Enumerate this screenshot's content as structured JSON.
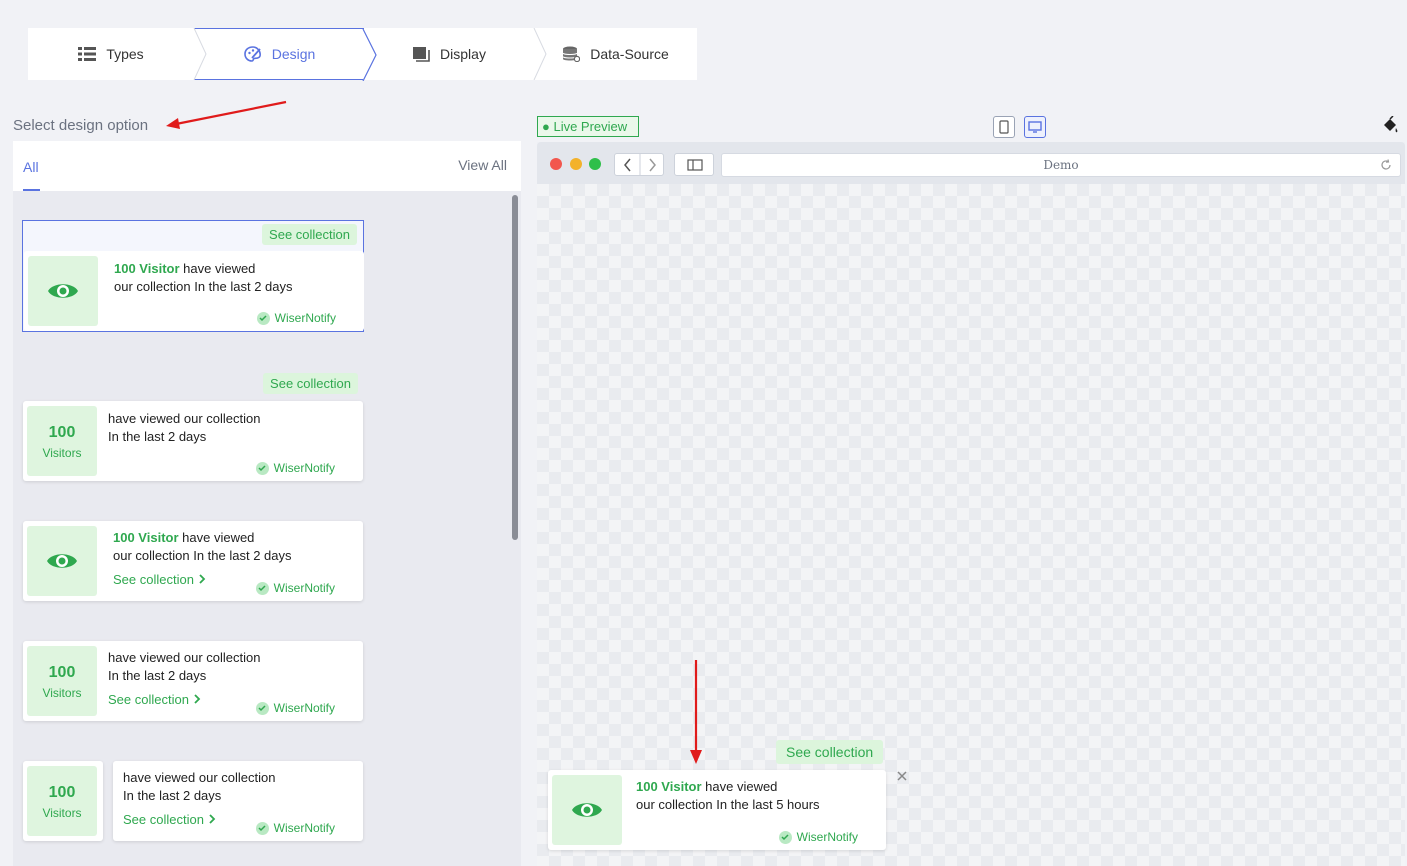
{
  "steps": [
    {
      "label": "Types",
      "icon": "list-icon"
    },
    {
      "label": "Design",
      "icon": "palette-icon",
      "active": true
    },
    {
      "label": "Display",
      "icon": "display-icon"
    },
    {
      "label": "Data-Source",
      "icon": "database-icon"
    }
  ],
  "left": {
    "title": "Select design option",
    "tab_all": "All",
    "view_all": "View All"
  },
  "cards": {
    "c1": {
      "badge": "See collection",
      "hl": "100 Visitor",
      "line1": " have viewed",
      "line2": "our collection In the last 2 days",
      "brand": "WiserNotify"
    },
    "c2": {
      "badge": "See collection",
      "num": "100",
      "unit": "Visitors",
      "line1": "have viewed our collection",
      "line2": "In the last 2 days",
      "brand": "WiserNotify"
    },
    "c3": {
      "hl": "100 Visitor",
      "line1": " have viewed",
      "line2": "our collection In the last 2 days",
      "link": "See collection",
      "brand": "WiserNotify"
    },
    "c4": {
      "num": "100",
      "unit": "Visitors",
      "line1": "have viewed our collection",
      "line2": "In the last 2 days",
      "link": "See collection",
      "brand": "WiserNotify"
    },
    "c5": {
      "num": "100",
      "unit": "Visitors",
      "line1": "have viewed our collection",
      "line2": "In the last 2 days",
      "link": "See collection",
      "brand": "WiserNotify"
    }
  },
  "preview": {
    "live_label": "Live Preview",
    "url": "Demo",
    "notif": {
      "badge": "See collection",
      "hl": "100 Visitor",
      "line1": " have viewed",
      "line2": "our collection In the last 5 hours",
      "brand": "WiserNotify"
    }
  },
  "colors": {
    "accent": "#5a73e0",
    "green": "#2fa84f",
    "arrow": "#e01b1b"
  }
}
